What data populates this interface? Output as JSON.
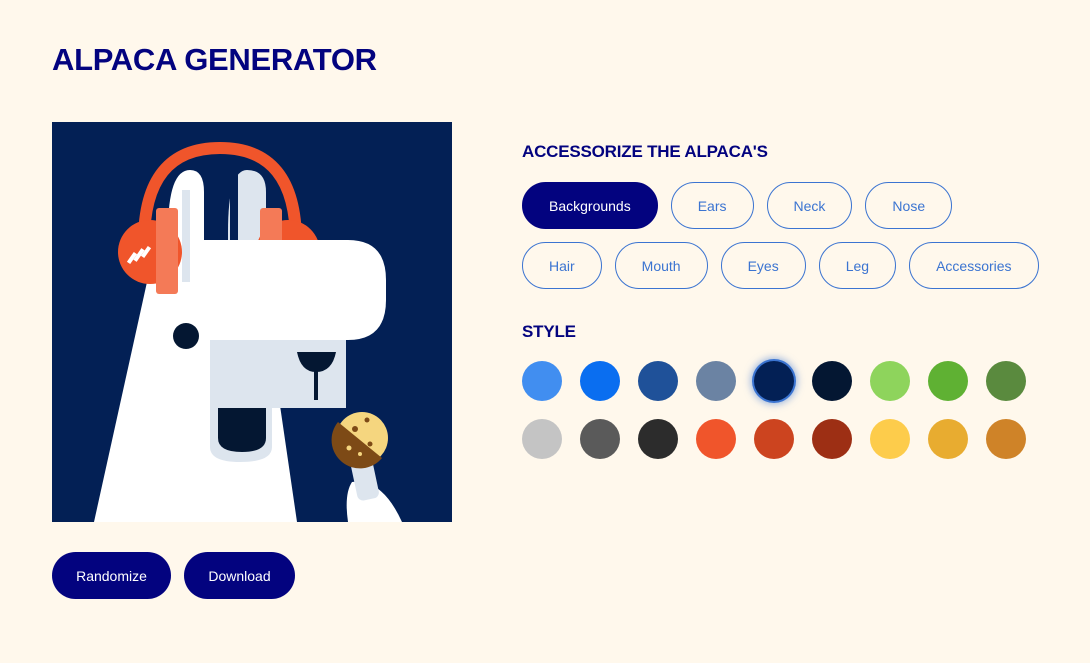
{
  "app": {
    "title": "ALPACA GENERATOR"
  },
  "actions": {
    "randomize": "Randomize",
    "download": "Download"
  },
  "accessorize": {
    "heading": "ACCESSORIZE THE ALPACA'S",
    "active": "Backgrounds",
    "categories": [
      "Backgrounds",
      "Ears",
      "Neck",
      "Nose",
      "Hair",
      "Mouth",
      "Eyes",
      "Leg",
      "Accessories"
    ]
  },
  "style": {
    "heading": "STYLE",
    "selected_index": 4,
    "swatches": [
      "#418ef0",
      "#0a6ef0",
      "#1f5199",
      "#6b83a3",
      "#032055",
      "#041732",
      "#8ed45c",
      "#5fb133",
      "#5a8a3e",
      "#c4c4c4",
      "#5a5a5a",
      "#2c2c2c",
      "#f0552b",
      "#cc441f",
      "#9d2f14",
      "#fdcc4b",
      "#e8ac30",
      "#cf8328"
    ]
  },
  "alpaca": {
    "background_color": "#032055",
    "headphones_color": "#f0552b",
    "body_color": "#ffffff",
    "muzzle_color": "#dde5ee",
    "cookie_color": "#f5d67f"
  }
}
